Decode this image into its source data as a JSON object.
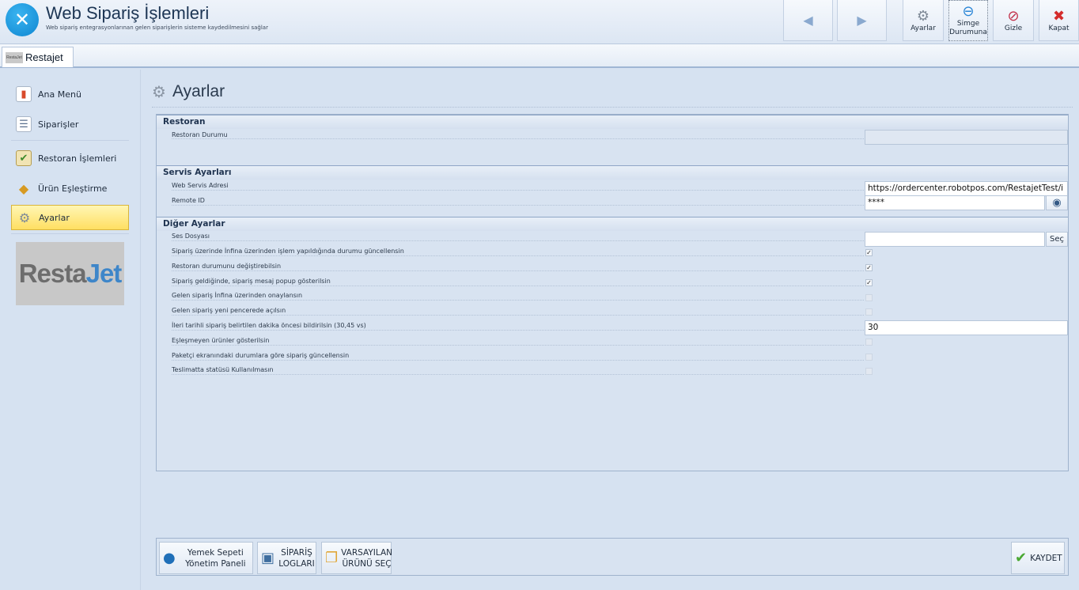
{
  "app": {
    "title": "Web Sipariş İşlemleri",
    "subtitle": "Web sipariş entegrasyonlarınan gelen siparişlerin sisteme kaydedilmesini sağlar"
  },
  "toolbar": {
    "back_icon": "◀",
    "forward_icon": "▶",
    "settings_label": "Ayarlar",
    "minimize_label_1": "Simge",
    "minimize_label_2": "Durumuna",
    "hide_label": "Gizle",
    "close_label": "Kapat"
  },
  "tab": {
    "logo_text": "RestaJet",
    "label": "Restajet"
  },
  "sidebar": {
    "items": [
      {
        "label": "Ana Menü",
        "icon": "chart-icon"
      },
      {
        "label": "Siparişler",
        "icon": "list-icon"
      },
      {
        "label": "Restoran İşlemleri",
        "icon": "clipboard-icon"
      },
      {
        "label": "Ürün Eşleştirme",
        "icon": "boxes-icon"
      },
      {
        "label": "Ayarlar",
        "icon": "gears-icon"
      }
    ],
    "logo_part1": "Resta",
    "logo_part2": "Jet"
  },
  "page": {
    "title": "Ayarlar"
  },
  "sections": {
    "restoran": {
      "title": "Restoran",
      "status_label": "Restoran Durumu",
      "status_value": ""
    },
    "servis": {
      "title": "Servis Ayarları",
      "url_label": "Web Servis Adresi",
      "url_value": "https://ordercenter.robotpos.com/RestajetTest/i",
      "remote_label": "Remote ID",
      "remote_value": "****"
    },
    "diger": {
      "title": "Diğer Ayarlar",
      "sound_label": "Ses Dosyası",
      "sound_value": "",
      "sound_button": "Seç",
      "options": [
        {
          "label": "Sipariş üzerinde İnfina üzerinden işlem yapıldığında durumu güncellensin",
          "checked": true
        },
        {
          "label": "Restoran durumunu değiştirebilsin",
          "checked": true
        },
        {
          "label": "Sipariş geldiğinde, sipariş mesaj popup gösterilsin",
          "checked": true
        },
        {
          "label": "Gelen sipariş İnfina üzerinden onaylansın",
          "checked": false
        },
        {
          "label": "Gelen sipariş yeni pencerede açılsın",
          "checked": false
        }
      ],
      "advance_label": "İleri tarihli sipariş belirtilen dakika öncesi bildirilsin (30,45 vs)",
      "advance_value": "30",
      "options2": [
        {
          "label": "Eşleşmeyen ürünler gösterilsin",
          "checked": false
        },
        {
          "label": "Paketçi ekranındaki durumlara göre sipariş güncellensin",
          "checked": false
        },
        {
          "label": "Teslimatta statüsü Kullanılmasın",
          "checked": false
        }
      ]
    }
  },
  "bottom": {
    "yemek_1": "Yemek Sepeti",
    "yemek_2": "Yönetim Paneli",
    "log_1": "SİPARİŞ",
    "log_2": "LOGLARI",
    "default_1": "VARSAYILAN",
    "default_2": "ÜRÜNÜ SEÇ",
    "save": "KAYDET"
  }
}
